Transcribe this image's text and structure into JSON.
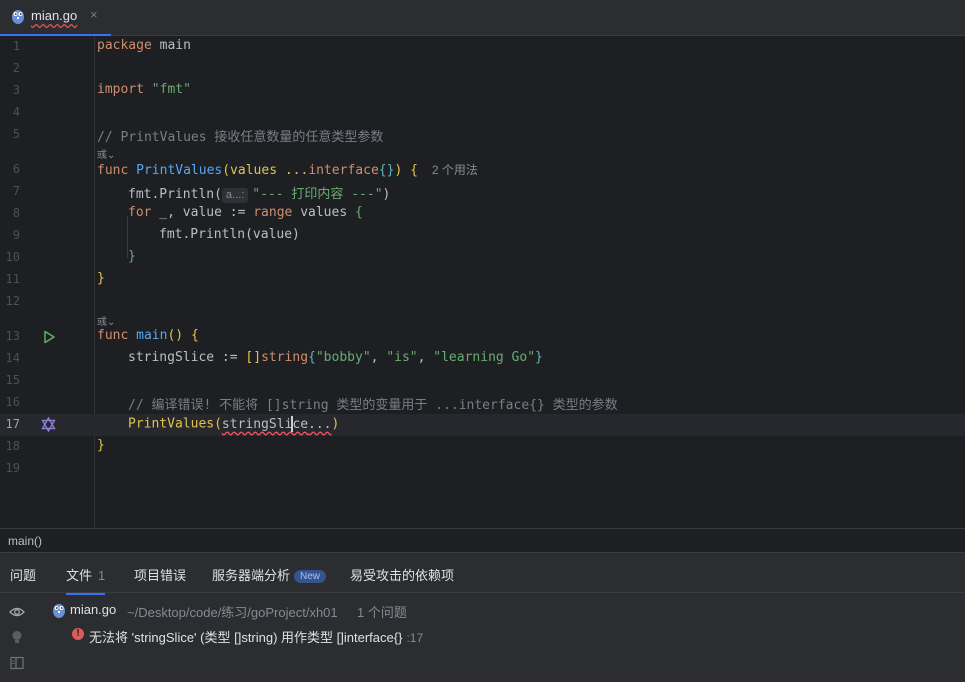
{
  "tab": {
    "filename": "mian.go",
    "close_glyph": "×"
  },
  "editor": {
    "line_numbers": [
      "1",
      "2",
      "3",
      "4",
      "5",
      "6",
      "7",
      "8",
      "9",
      "10",
      "11",
      "12",
      "13",
      "14",
      "15",
      "16",
      "17",
      "18",
      "19"
    ],
    "current_line": "17",
    "code": {
      "l1_kw": "package",
      "l1_rest": " main",
      "l3_kw": "import",
      "l3_str": "\"fmt\"",
      "l5": "// PrintValues 接收任意数量的任意类型参数",
      "anno": "彧⌄",
      "l6_kw": "func",
      "l6_fn": "PrintValues",
      "l6_p1": "(values ...",
      "l6_kw2": "interface",
      "l6_b1": "{}",
      "l6_p2": ")",
      "l6_b2": "{",
      "l6_usages": "2 个用法",
      "l7_a": "fmt.Println(",
      "l7_hint": "a...:",
      "l7_str": "\"--- 打印内容 ---\"",
      "l7_b": ")",
      "l8_kw": "for",
      "l8_a": " _, value := ",
      "l8_kw2": "range",
      "l8_b": " values ",
      "l8_br": "{",
      "l9": "fmt.Println(value)",
      "l10": "}",
      "l11": "}",
      "l13_kw": "func",
      "l13_fn": "main",
      "l13_p": "()",
      "l13_br": "{",
      "l14_a": "stringSlice := ",
      "l14_br": "[]",
      "l14_kw": "string",
      "l14_b1": "{",
      "l14_s1": "\"bobby\"",
      "l14_c1": ", ",
      "l14_s2": "\"is\"",
      "l14_c2": ", ",
      "l14_s3": "\"learning Go\"",
      "l14_b2": "}",
      "l16": "// 编译错误! 不能将 []string 类型的变量用于 ...interface{} 类型的参数",
      "l17_fn": "PrintValues",
      "l17_p1": "(",
      "l17_arg_a": "stringSli",
      "l17_arg_b": "ce",
      "l17_rest": "...",
      "l17_p2": ")",
      "l18": "}"
    }
  },
  "breadcrumb": "main()",
  "problems": {
    "tabs": [
      {
        "label": "问题"
      },
      {
        "label": "文件",
        "count": "1"
      },
      {
        "label": "项目错误"
      },
      {
        "label": "服务器端分析",
        "badge": "New"
      },
      {
        "label": "易受攻击的依赖项"
      }
    ],
    "file": {
      "name": "mian.go",
      "path": "~/Desktop/code/练习/goProject/xh01",
      "count": "1 个问题"
    },
    "issue": {
      "message": "无法将 'stringSlice' (类型 []string) 用作类型 []interface{}",
      "location": ":17"
    }
  },
  "colors": {
    "accent": "#3574f0",
    "error": "#db5c5c",
    "keyword": "#cf8e6d",
    "function": "#56a8f5",
    "string": "#6aab73"
  }
}
